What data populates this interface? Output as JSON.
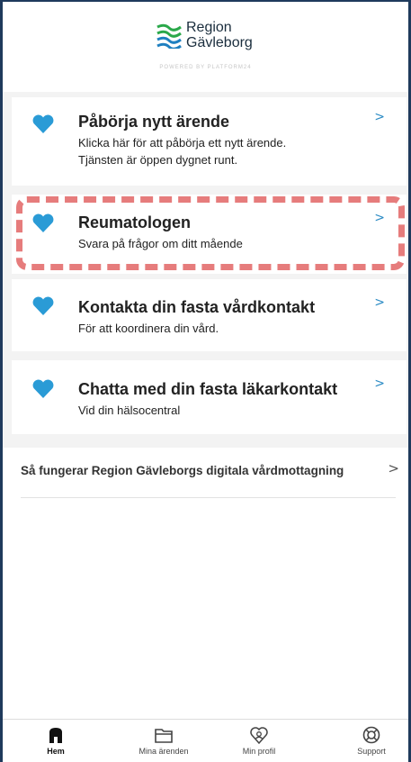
{
  "brand": {
    "name_line1": "Region",
    "name_line2": "Gävleborg",
    "powered_by": "POWERED BY PLATFORM24",
    "colors": {
      "logo_green": "#2aa84a",
      "logo_blue": "#1e7fc0"
    }
  },
  "accent": {
    "heart": "#2a9bd6",
    "chevron": "#2a8ac4",
    "highlight": "#e67c7c"
  },
  "cards": [
    {
      "title": "Påbörja nytt ärende",
      "subtitle_line1": "Klicka här för att påbörja ett nytt ärende.",
      "subtitle_line2": "Tjänsten är öppen dygnet runt.",
      "icon": "heart-icon",
      "chevron": ">"
    },
    {
      "title": "Reumatologen",
      "subtitle_line1": "Svara på frågor om ditt mående",
      "icon": "heart-icon",
      "chevron": ">",
      "highlighted": true
    },
    {
      "title": "Kontakta din fasta vårdkontakt",
      "subtitle_line1": "För att koordinera din vård.",
      "icon": "heart-icon",
      "chevron": ">"
    },
    {
      "title": "Chatta med din fasta läkarkontakt",
      "subtitle_line1": "Vid din hälsocentral",
      "icon": "heart-icon",
      "chevron": ">"
    }
  ],
  "info_link": {
    "label": "Så fungerar Region Gävleborgs digitala vårdmottagning",
    "chevron": ">"
  },
  "tabbar": [
    {
      "label": "Hem",
      "icon": "home-icon",
      "active": true
    },
    {
      "label": "Mina ärenden",
      "icon": "folder-icon",
      "active": false
    },
    {
      "label": "Min profil",
      "icon": "profile-icon",
      "active": false
    },
    {
      "label": "Support",
      "icon": "support-icon",
      "active": false
    }
  ]
}
